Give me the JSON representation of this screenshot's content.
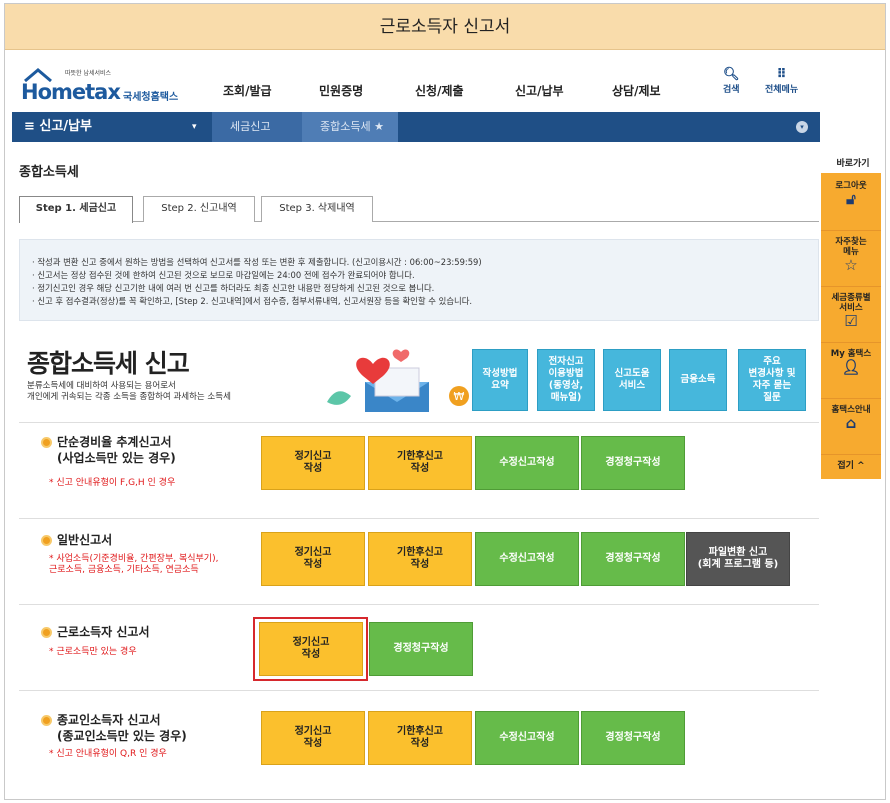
{
  "banner_title": "근로소득자 신고서",
  "logo": {
    "tiny": "따뜻한 납세서비스",
    "text": "Hometax",
    "sub": "국세청홈택스"
  },
  "nav": [
    "조회/발급",
    "민원증명",
    "신청/제출",
    "신고/납부",
    "상담/제보"
  ],
  "tools": {
    "search_icon": "search-icon",
    "search": "검색",
    "all_menu_icon": "grid-icon",
    "all_menu": "전체메뉴"
  },
  "subbar": {
    "title": "≡ 신고/납부",
    "dropdown": "▾",
    "crumb1": "세금신고",
    "crumb2": "종합소득세 ★",
    "more": "▾"
  },
  "page_title": "종합소득세",
  "tabs": [
    "Step 1. 세금신고",
    "Step 2. 신고내역",
    "Step 3. 삭제내역"
  ],
  "info": [
    "· 작성과 변환 신고 중에서 원하는 방법을 선택하여 신고서를 작성 또는 변환 후 제출합니다. (신고이용시간 : 06:00~23:59:59)",
    "· 신고서는 정상 접수된 것에 한하여 신고된 것으로 보므로 마감일에는 24:00 전에 접수가 완료되어야 합니다.",
    "· 정기신고인 경우 해당 신고기한 내에 여러 번 신고를 하더라도 최종 신고한 내용만 정당하게 신고된 것으로 봅니다.",
    "· 신고 후 접수결과(정상)를 꼭 확인하고, [Step 2. 신고내역]에서 접수증, 첨부서류내역, 신고서원장 등을 확인할 수 있습니다."
  ],
  "big_title": "종합소득세 신고",
  "big_sub1": "분류소득세에 대비하여 사용되는 용어로서",
  "big_sub2": "개인에게 귀속되는 각종 소득을 종합하여 과세하는 소득세",
  "quick": [
    "작성방법\n요약",
    "전자신고\n이용방법\n(동영상,\n매뉴얼)",
    "신고도움\n서비스",
    "금융소득",
    "주요\n변경사항 및\n자주 묻는\n질문"
  ],
  "sections": [
    {
      "name": "단순경비율 추계신고서\n(사업소득만 있는 경우)",
      "note": "* 신고 안내유형이 F,G,H 인 경우",
      "buttons": [
        "정기신고\n작성",
        "기한후신고\n작성",
        "수정신고작성",
        "경정청구작성"
      ]
    },
    {
      "name": "일반신고서",
      "note": "* 사업소득(기준경비율, 간편장부, 복식부기),\n근로소득, 금융소득, 기타소득, 연금소득",
      "buttons": [
        "정기신고\n작성",
        "기한후신고\n작성",
        "수정신고작성",
        "경정청구작성",
        "파일변환 신고\n(회계 프로그램 등)"
      ]
    },
    {
      "name": "근로소득자 신고서",
      "note": "* 근로소득만 있는 경우",
      "buttons": [
        "정기신고\n작성",
        "경정청구작성"
      ]
    },
    {
      "name": "종교인소득자 신고서\n(종교인소득만 있는 경우)",
      "note": "* 신고 안내유형이 Q,R 인 경우",
      "buttons": [
        "정기신고\n작성",
        "기한후신고\n작성",
        "수정신고작성",
        "경정청구작성"
      ]
    }
  ],
  "side": {
    "head": "바로가기",
    "items": [
      "로그아웃",
      "자주찾는\n메뉴",
      "세금종류별\n서비스",
      "My 홈택스",
      "홈택스안내"
    ],
    "close": "접기 ^"
  },
  "colors": {
    "banner": "#f9dcab",
    "navy": "#1f4f86",
    "yellow": "#fbc02d",
    "green": "#66bb4a",
    "sky": "#46b7dc",
    "orange": "#f7aa2f",
    "red": "#d6282d"
  }
}
